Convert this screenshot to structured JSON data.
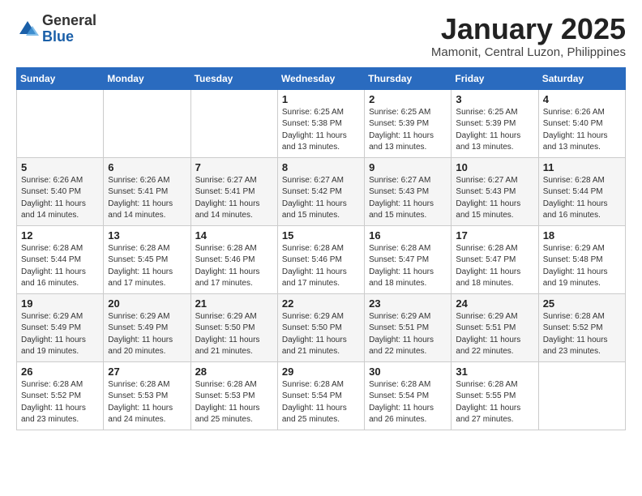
{
  "logo": {
    "general": "General",
    "blue": "Blue"
  },
  "title": "January 2025",
  "location": "Mamonit, Central Luzon, Philippines",
  "weekdays": [
    "Sunday",
    "Monday",
    "Tuesday",
    "Wednesday",
    "Thursday",
    "Friday",
    "Saturday"
  ],
  "weeks": [
    [
      {
        "day": "",
        "sunrise": "",
        "sunset": "",
        "daylight": ""
      },
      {
        "day": "",
        "sunrise": "",
        "sunset": "",
        "daylight": ""
      },
      {
        "day": "",
        "sunrise": "",
        "sunset": "",
        "daylight": ""
      },
      {
        "day": "1",
        "sunrise": "Sunrise: 6:25 AM",
        "sunset": "Sunset: 5:38 PM",
        "daylight": "Daylight: 11 hours and 13 minutes."
      },
      {
        "day": "2",
        "sunrise": "Sunrise: 6:25 AM",
        "sunset": "Sunset: 5:39 PM",
        "daylight": "Daylight: 11 hours and 13 minutes."
      },
      {
        "day": "3",
        "sunrise": "Sunrise: 6:25 AM",
        "sunset": "Sunset: 5:39 PM",
        "daylight": "Daylight: 11 hours and 13 minutes."
      },
      {
        "day": "4",
        "sunrise": "Sunrise: 6:26 AM",
        "sunset": "Sunset: 5:40 PM",
        "daylight": "Daylight: 11 hours and 13 minutes."
      }
    ],
    [
      {
        "day": "5",
        "sunrise": "Sunrise: 6:26 AM",
        "sunset": "Sunset: 5:40 PM",
        "daylight": "Daylight: 11 hours and 14 minutes."
      },
      {
        "day": "6",
        "sunrise": "Sunrise: 6:26 AM",
        "sunset": "Sunset: 5:41 PM",
        "daylight": "Daylight: 11 hours and 14 minutes."
      },
      {
        "day": "7",
        "sunrise": "Sunrise: 6:27 AM",
        "sunset": "Sunset: 5:41 PM",
        "daylight": "Daylight: 11 hours and 14 minutes."
      },
      {
        "day": "8",
        "sunrise": "Sunrise: 6:27 AM",
        "sunset": "Sunset: 5:42 PM",
        "daylight": "Daylight: 11 hours and 15 minutes."
      },
      {
        "day": "9",
        "sunrise": "Sunrise: 6:27 AM",
        "sunset": "Sunset: 5:43 PM",
        "daylight": "Daylight: 11 hours and 15 minutes."
      },
      {
        "day": "10",
        "sunrise": "Sunrise: 6:27 AM",
        "sunset": "Sunset: 5:43 PM",
        "daylight": "Daylight: 11 hours and 15 minutes."
      },
      {
        "day": "11",
        "sunrise": "Sunrise: 6:28 AM",
        "sunset": "Sunset: 5:44 PM",
        "daylight": "Daylight: 11 hours and 16 minutes."
      }
    ],
    [
      {
        "day": "12",
        "sunrise": "Sunrise: 6:28 AM",
        "sunset": "Sunset: 5:44 PM",
        "daylight": "Daylight: 11 hours and 16 minutes."
      },
      {
        "day": "13",
        "sunrise": "Sunrise: 6:28 AM",
        "sunset": "Sunset: 5:45 PM",
        "daylight": "Daylight: 11 hours and 17 minutes."
      },
      {
        "day": "14",
        "sunrise": "Sunrise: 6:28 AM",
        "sunset": "Sunset: 5:46 PM",
        "daylight": "Daylight: 11 hours and 17 minutes."
      },
      {
        "day": "15",
        "sunrise": "Sunrise: 6:28 AM",
        "sunset": "Sunset: 5:46 PM",
        "daylight": "Daylight: 11 hours and 17 minutes."
      },
      {
        "day": "16",
        "sunrise": "Sunrise: 6:28 AM",
        "sunset": "Sunset: 5:47 PM",
        "daylight": "Daylight: 11 hours and 18 minutes."
      },
      {
        "day": "17",
        "sunrise": "Sunrise: 6:28 AM",
        "sunset": "Sunset: 5:47 PM",
        "daylight": "Daylight: 11 hours and 18 minutes."
      },
      {
        "day": "18",
        "sunrise": "Sunrise: 6:29 AM",
        "sunset": "Sunset: 5:48 PM",
        "daylight": "Daylight: 11 hours and 19 minutes."
      }
    ],
    [
      {
        "day": "19",
        "sunrise": "Sunrise: 6:29 AM",
        "sunset": "Sunset: 5:49 PM",
        "daylight": "Daylight: 11 hours and 19 minutes."
      },
      {
        "day": "20",
        "sunrise": "Sunrise: 6:29 AM",
        "sunset": "Sunset: 5:49 PM",
        "daylight": "Daylight: 11 hours and 20 minutes."
      },
      {
        "day": "21",
        "sunrise": "Sunrise: 6:29 AM",
        "sunset": "Sunset: 5:50 PM",
        "daylight": "Daylight: 11 hours and 21 minutes."
      },
      {
        "day": "22",
        "sunrise": "Sunrise: 6:29 AM",
        "sunset": "Sunset: 5:50 PM",
        "daylight": "Daylight: 11 hours and 21 minutes."
      },
      {
        "day": "23",
        "sunrise": "Sunrise: 6:29 AM",
        "sunset": "Sunset: 5:51 PM",
        "daylight": "Daylight: 11 hours and 22 minutes."
      },
      {
        "day": "24",
        "sunrise": "Sunrise: 6:29 AM",
        "sunset": "Sunset: 5:51 PM",
        "daylight": "Daylight: 11 hours and 22 minutes."
      },
      {
        "day": "25",
        "sunrise": "Sunrise: 6:28 AM",
        "sunset": "Sunset: 5:52 PM",
        "daylight": "Daylight: 11 hours and 23 minutes."
      }
    ],
    [
      {
        "day": "26",
        "sunrise": "Sunrise: 6:28 AM",
        "sunset": "Sunset: 5:52 PM",
        "daylight": "Daylight: 11 hours and 23 minutes."
      },
      {
        "day": "27",
        "sunrise": "Sunrise: 6:28 AM",
        "sunset": "Sunset: 5:53 PM",
        "daylight": "Daylight: 11 hours and 24 minutes."
      },
      {
        "day": "28",
        "sunrise": "Sunrise: 6:28 AM",
        "sunset": "Sunset: 5:53 PM",
        "daylight": "Daylight: 11 hours and 25 minutes."
      },
      {
        "day": "29",
        "sunrise": "Sunrise: 6:28 AM",
        "sunset": "Sunset: 5:54 PM",
        "daylight": "Daylight: 11 hours and 25 minutes."
      },
      {
        "day": "30",
        "sunrise": "Sunrise: 6:28 AM",
        "sunset": "Sunset: 5:54 PM",
        "daylight": "Daylight: 11 hours and 26 minutes."
      },
      {
        "day": "31",
        "sunrise": "Sunrise: 6:28 AM",
        "sunset": "Sunset: 5:55 PM",
        "daylight": "Daylight: 11 hours and 27 minutes."
      },
      {
        "day": "",
        "sunrise": "",
        "sunset": "",
        "daylight": ""
      }
    ]
  ]
}
